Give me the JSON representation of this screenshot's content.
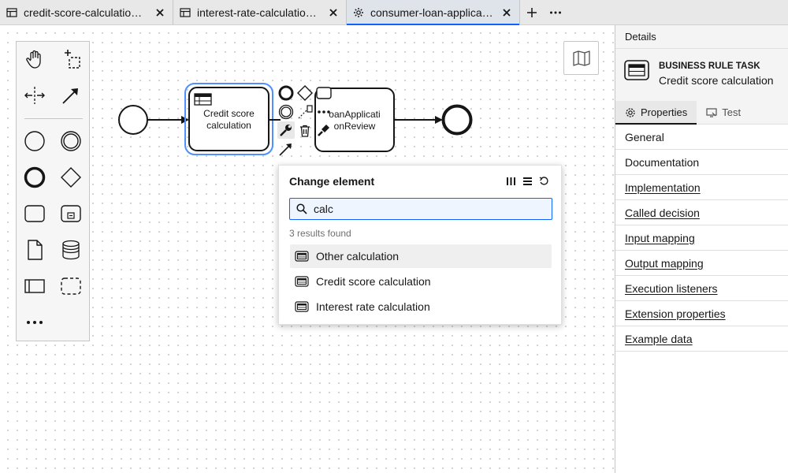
{
  "tabs": [
    {
      "label": "credit-score-calculation.dmn",
      "icon": "table-icon",
      "active": false
    },
    {
      "label": "interest-rate-calculation.dmn",
      "icon": "table-icon",
      "active": false
    },
    {
      "label": "consumer-loan-application.bpmn",
      "icon": "gear-icon",
      "active": true
    }
  ],
  "diagram": {
    "task1_line1": "Credit score",
    "task1_line2": "calculation",
    "task2_line1": "oanApplicati",
    "task2_line2": "onReview"
  },
  "popup": {
    "title": "Change element",
    "search_value": "calc",
    "count": "3 results found",
    "results": [
      "Other calculation",
      "Credit score calculation",
      "Interest rate calculation"
    ]
  },
  "panel": {
    "header": "Details",
    "element_type": "BUSINESS RULE TASK",
    "element_name": "Credit score calculation",
    "tabs": [
      "Properties",
      "Test"
    ],
    "groups": [
      "General",
      "Documentation",
      "Implementation",
      "Called decision",
      "Input mapping",
      "Output mapping",
      "Execution listeners",
      "Extension properties",
      "Example data"
    ]
  },
  "colors": {
    "accent": "#0f62fe",
    "selection": "#4d90fe"
  }
}
